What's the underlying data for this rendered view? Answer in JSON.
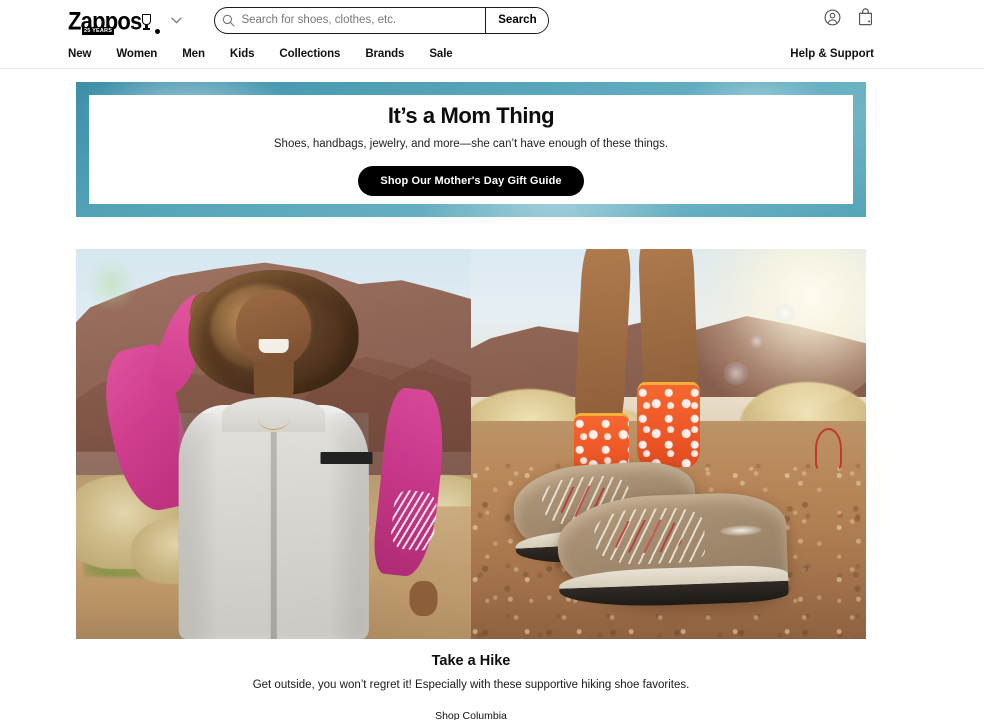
{
  "header": {
    "logo": {
      "name": "Zappos",
      "tagline": "25 YEARS",
      "badge_icon": "trophy-icon",
      "chevron_icon": "chevron-down-icon"
    },
    "search": {
      "placeholder": "Search for shoes, clothes, etc.",
      "value": "",
      "button_label": "Search",
      "icon": "search-icon"
    },
    "account_icon": "account-circle-icon",
    "bag_icon": "shopping-bag-icon",
    "help_label": "Help & Support",
    "nav": [
      {
        "label": "New"
      },
      {
        "label": "Women"
      },
      {
        "label": "Men"
      },
      {
        "label": "Kids"
      },
      {
        "label": "Collections"
      },
      {
        "label": "Brands"
      },
      {
        "label": "Sale"
      }
    ]
  },
  "promo": {
    "title": "It’s a Mom Thing",
    "subtitle": "Shoes, handbags, jewelry, and more—she can’t have enough of these things.",
    "cta_label": "Shop Our Mother's Day Gift Guide",
    "border_color": "#58a6bb",
    "cta_background": "#000000"
  },
  "hero": {
    "left_image_alt": "Smiling woman in grey fleece vest and pink long-sleeve top standing on a desert trail",
    "right_image_alt": "Tan Columbia hiking shoes with orange citrus-print socks on a dirt trail"
  },
  "caption": {
    "title": "Take a Hike",
    "subtitle": "Get outside, you won’t regret it! Especially with these supportive hiking shoe favorites.",
    "link_label": "Shop Columbia"
  }
}
